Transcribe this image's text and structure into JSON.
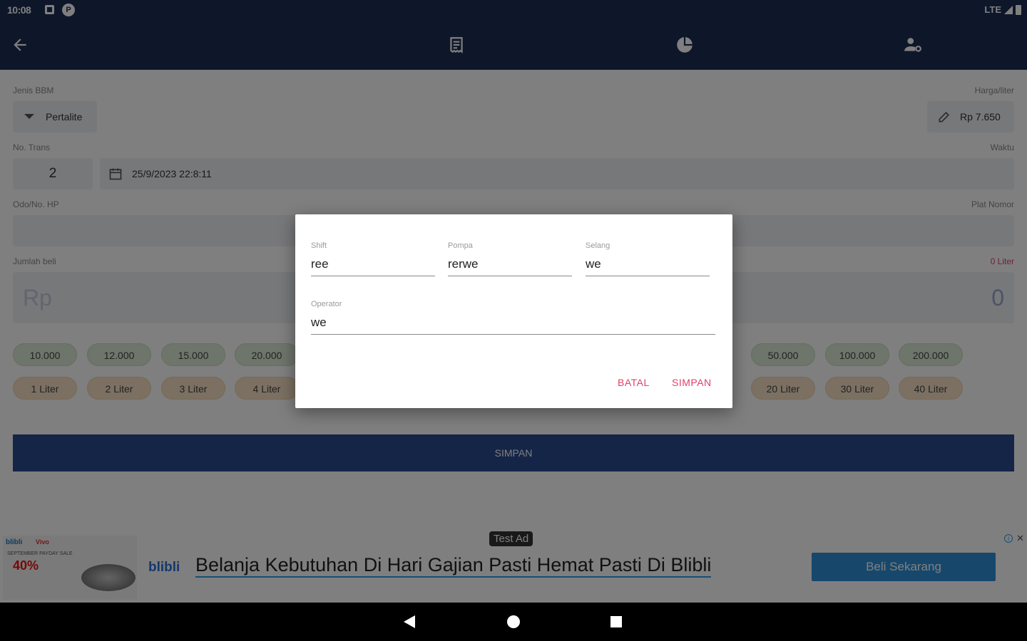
{
  "status_bar": {
    "time": "10:08",
    "network": "LTE",
    "notif_icon_2": "P"
  },
  "app_bar": {
    "icons": [
      "back-arrow-icon",
      "receipt-icon",
      "chart-icon",
      "user-settings-icon"
    ]
  },
  "form": {
    "fuel_type_label": "Jenis BBM",
    "fuel_type_value": "Pertalite",
    "price_label": "Harga/liter",
    "price_value": "Rp 7.650",
    "transaction_no_label": "No. Trans",
    "transaction_no_value": "2",
    "time_label": "Waktu",
    "datetime_value": "25/9/2023 22:8:11",
    "odo_label": "Odo/No. HP",
    "plate_label": "Plat Nomor",
    "amount_label": "Jumlah beli",
    "liter_label": "0 Liter",
    "amount_prefix": "Rp",
    "amount_value": "0",
    "money_chips": [
      "10.000",
      "12.000",
      "15.000",
      "20.000",
      "50.000",
      "100.000",
      "200.000"
    ],
    "liter_chips": [
      "1 Liter",
      "2 Liter",
      "3 Liter",
      "4 Liter",
      "20 Liter",
      "30 Liter",
      "40 Liter"
    ],
    "save_label": "SIMPAN"
  },
  "dialog": {
    "shift_label": "Shift",
    "shift_value": "ree",
    "pompa_label": "Pompa",
    "pompa_value": "rerwe",
    "selang_label": "Selang",
    "selang_value": "we",
    "operator_label": "Operator",
    "operator_value": "we",
    "cancel_label": "BATAL",
    "save_label": "SIMPAN"
  },
  "ad": {
    "badge": "Test Ad",
    "brand": "blibli",
    "headline": "Belanja Kebutuhan Di Hari Gajian Pasti Hemat Pasti Di Blibli",
    "cta": "Beli Sekarang",
    "thumb_brand1": "blibli",
    "thumb_brand2": "Vivo",
    "thumb_sale": "SEPTEMBER PAYDAY SALE",
    "thumb_percent": "40%"
  },
  "colors": {
    "primary": "#1c2d55",
    "button": "#2b4a8e",
    "accent": "#e0406a"
  }
}
